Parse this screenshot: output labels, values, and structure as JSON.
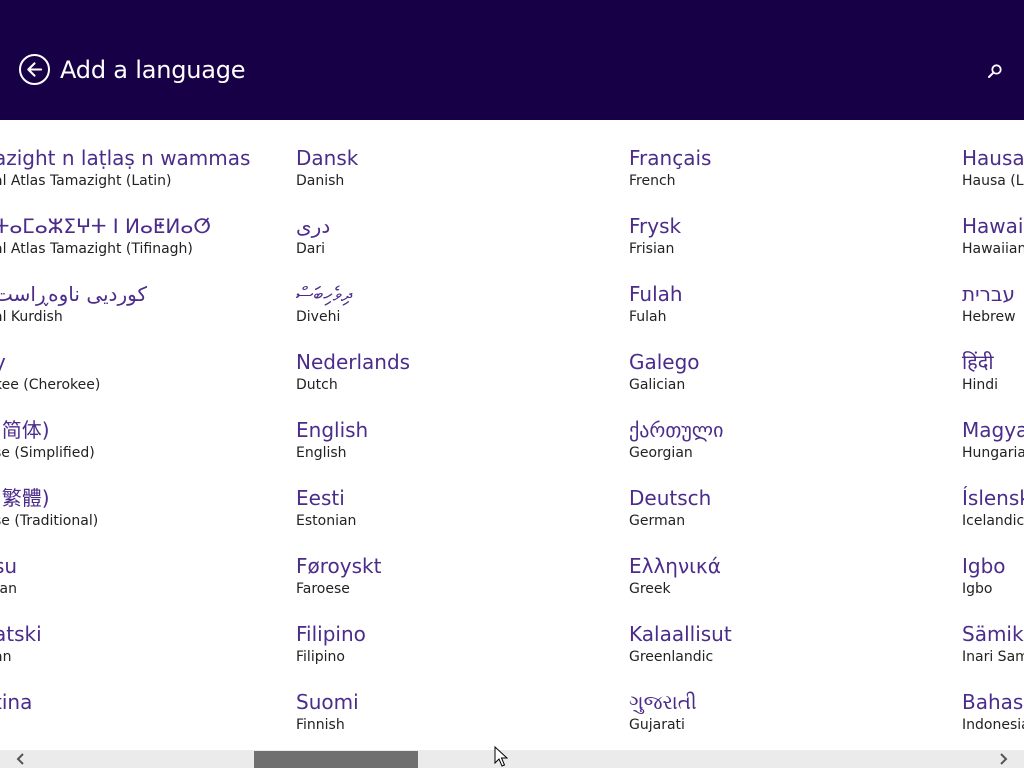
{
  "header": {
    "title": "Add a language",
    "back_icon": "back-arrow-icon",
    "search_icon": "search-icon"
  },
  "columns": [
    [
      {
        "native": "azight n laṭlaṣ n wammas",
        "english": "al Atlas Tamazight (Latin)"
      },
      {
        "native": "ⵜⴰⵎⴰⵣⵉⵖⵜ ⵏ ⵍⴰⵟⵍⴰⵚ",
        "english": "al Atlas Tamazight (Tifinagh)"
      },
      {
        "native": "كوردیی ناوەڕاست",
        "english": "al Kurdish"
      },
      {
        "native": "y",
        "english": "kee (Cherokee)"
      },
      {
        "native": "(简体)",
        "english": "se (Simplified)"
      },
      {
        "native": "(繁體)",
        "english": "se (Traditional)"
      },
      {
        "native": "su",
        "english": "tan"
      },
      {
        "native": "atski",
        "english": "an"
      },
      {
        "native": "tina",
        "english": ""
      }
    ],
    [
      {
        "native": "Dansk",
        "english": "Danish"
      },
      {
        "native": "درى",
        "english": "Dari"
      },
      {
        "native": "ދިވެހިބަސް",
        "english": "Divehi"
      },
      {
        "native": "Nederlands",
        "english": "Dutch"
      },
      {
        "native": "English",
        "english": "English"
      },
      {
        "native": "Eesti",
        "english": "Estonian"
      },
      {
        "native": "Føroyskt",
        "english": "Faroese"
      },
      {
        "native": "Filipino",
        "english": "Filipino"
      },
      {
        "native": "Suomi",
        "english": "Finnish"
      }
    ],
    [
      {
        "native": "Français",
        "english": "French"
      },
      {
        "native": "Frysk",
        "english": "Frisian"
      },
      {
        "native": "Fulah",
        "english": "Fulah"
      },
      {
        "native": "Galego",
        "english": "Galician"
      },
      {
        "native": "ქართული",
        "english": "Georgian"
      },
      {
        "native": "Deutsch",
        "english": "German"
      },
      {
        "native": "Ελληνικά",
        "english": "Greek"
      },
      {
        "native": "Kalaallisut",
        "english": "Greenlandic"
      },
      {
        "native": "ગુજરાતી",
        "english": "Gujarati"
      }
    ],
    [
      {
        "native": "Hausa",
        "english": "Hausa (La"
      },
      {
        "native": "Hawai'",
        "english": "Hawaiian"
      },
      {
        "native": "עברית",
        "english": "Hebrew"
      },
      {
        "native": "हिंदी",
        "english": "Hindi"
      },
      {
        "native": "Magya",
        "english": "Hungarian"
      },
      {
        "native": "Íslensk",
        "english": "Icelandic"
      },
      {
        "native": "Igbo",
        "english": "Igbo"
      },
      {
        "native": "Sämikie",
        "english": "Inari Sami"
      },
      {
        "native": "Bahasa",
        "english": "Indonesian"
      }
    ]
  ],
  "scrollbar": {
    "left_icon": "chevron-left-icon",
    "right_icon": "chevron-right-icon"
  },
  "colors": {
    "header_bg": "#180047",
    "native_text": "#4b2c8a",
    "english_text": "#222222"
  }
}
